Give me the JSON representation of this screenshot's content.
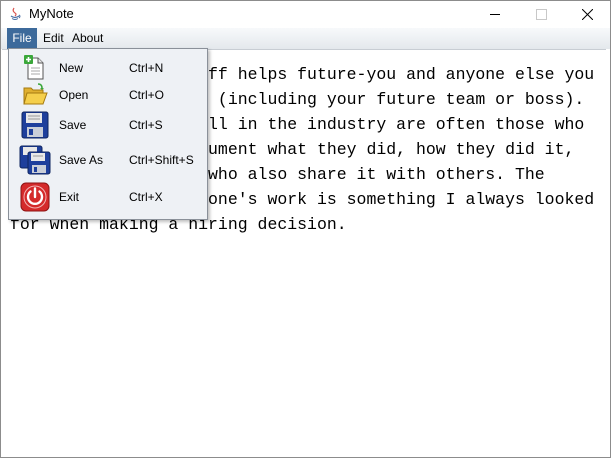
{
  "window": {
    "title": "MyNote"
  },
  "menubar": {
    "file": "File",
    "edit": "Edit",
    "about": "About"
  },
  "file_menu": {
    "items": [
      {
        "label": "New",
        "shortcut": "Ctrl+N",
        "icon": "new-document-icon"
      },
      {
        "label": "Open",
        "shortcut": "Ctrl+O",
        "icon": "open-folder-icon"
      },
      {
        "label": "Save",
        "shortcut": "Ctrl+S",
        "icon": "save-floppy-icon"
      },
      {
        "label": "Save As",
        "shortcut": "Ctrl+Shift+S",
        "icon": "save-as-floppy-icon"
      },
      {
        "label": "Exit",
        "shortcut": "Ctrl+X",
        "icon": "exit-power-icon"
      }
    ]
  },
  "editor": {
    "text": "Documenting your stuff helps future-you and anyone else you might ever work with (including your future team or boss). The people who do well in the industry are often those who take the time to document what they did, how they did it, why they did it and who also share it with others. The ability to document one's work is something I always looked for when making a hiring decision."
  },
  "colors": {
    "menu_highlight": "#3d6a9b",
    "exit_red": "#d42a2a",
    "save_blue": "#1e3f9c"
  }
}
